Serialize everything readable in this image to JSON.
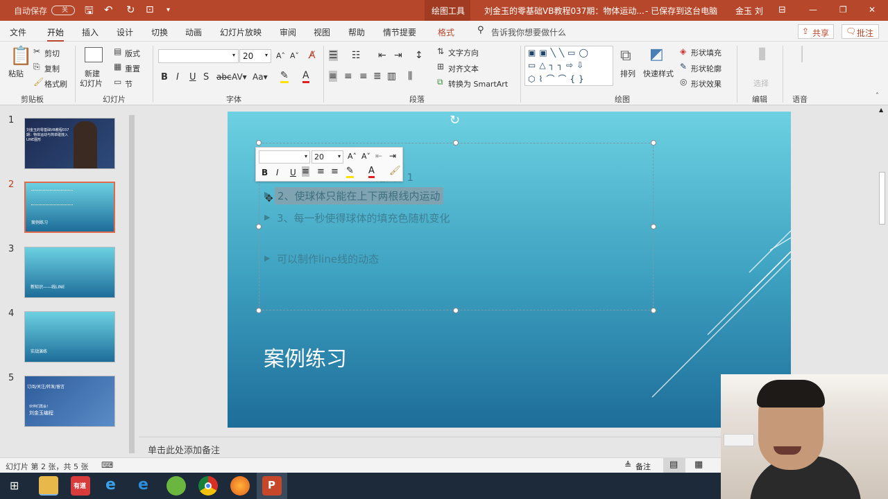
{
  "titlebar": {
    "autosave": "自动保存",
    "autosave_state": "关",
    "context_tab": "绘图工具",
    "doc_title": "刘金玉的零基础VB教程037期：物体运动...",
    "save_status": "- 已保存到这台电脑",
    "user": "金玉 刘"
  },
  "tabs": [
    "文件",
    "开始",
    "插入",
    "设计",
    "切换",
    "动画",
    "幻灯片放映",
    "审阅",
    "视图",
    "帮助",
    "情节提要",
    "格式"
  ],
  "tell_me": "告诉我你想要做什么",
  "share": "共享",
  "comment": "批注",
  "ribbon": {
    "clipboard": {
      "paste": "粘贴",
      "cut": "剪切",
      "copy": "复制",
      "format_painter": "格式刷",
      "label": "剪贴板"
    },
    "slides": {
      "new_slide": "新建",
      "new_slide2": "幻灯片",
      "layout": "版式",
      "reset": "重置",
      "section": "节",
      "label": "幻灯片"
    },
    "font": {
      "size": "20",
      "label": "字体",
      "bold": "B",
      "italic": "I",
      "underline": "U",
      "shadow": "S"
    },
    "paragraph": {
      "text_dir": "文字方向",
      "align_text": "对齐文本",
      "smartart": "转换为 SmartArt",
      "label": "段落"
    },
    "drawing": {
      "arrange": "排列",
      "quick_styles": "快速样式",
      "fill": "形状填充",
      "outline": "形状轮廓",
      "effects": "形状效果",
      "label": "绘图"
    },
    "editing": {
      "select": "选择",
      "label": "编辑"
    },
    "voice": {
      "label": "语音"
    }
  },
  "thumbnails": [
    {
      "num": "1",
      "text": "刘金玉的零基础VB教程037期：物体运动与简单碰撞入LINE图形"
    },
    {
      "num": "2",
      "text": "案例练习"
    },
    {
      "num": "3",
      "text": "新知识——线LINE"
    },
    {
      "num": "4",
      "text": "实战演练"
    },
    {
      "num": "5",
      "text": "订阅/关注/转发/留言",
      "text2": "刘金玉编程",
      "text3": "伙伴们再会！"
    }
  ],
  "slide": {
    "bullet1": "1、调到上下范围",
    "bullet2": "2、使球体只能在上下两根线内运动",
    "bullet3": "3、每一秒使得球体的填充色随机变化",
    "bullet4": "可以制作line线的动态",
    "title": "案例练习"
  },
  "mini_toolbar": {
    "size": "20",
    "bold": "B",
    "italic": "I",
    "underline": "U"
  },
  "notes_placeholder": "单击此处添加备注",
  "status": {
    "slide_info": "幻灯片 第 2 张，共 5 张",
    "notes_btn": "备注"
  }
}
